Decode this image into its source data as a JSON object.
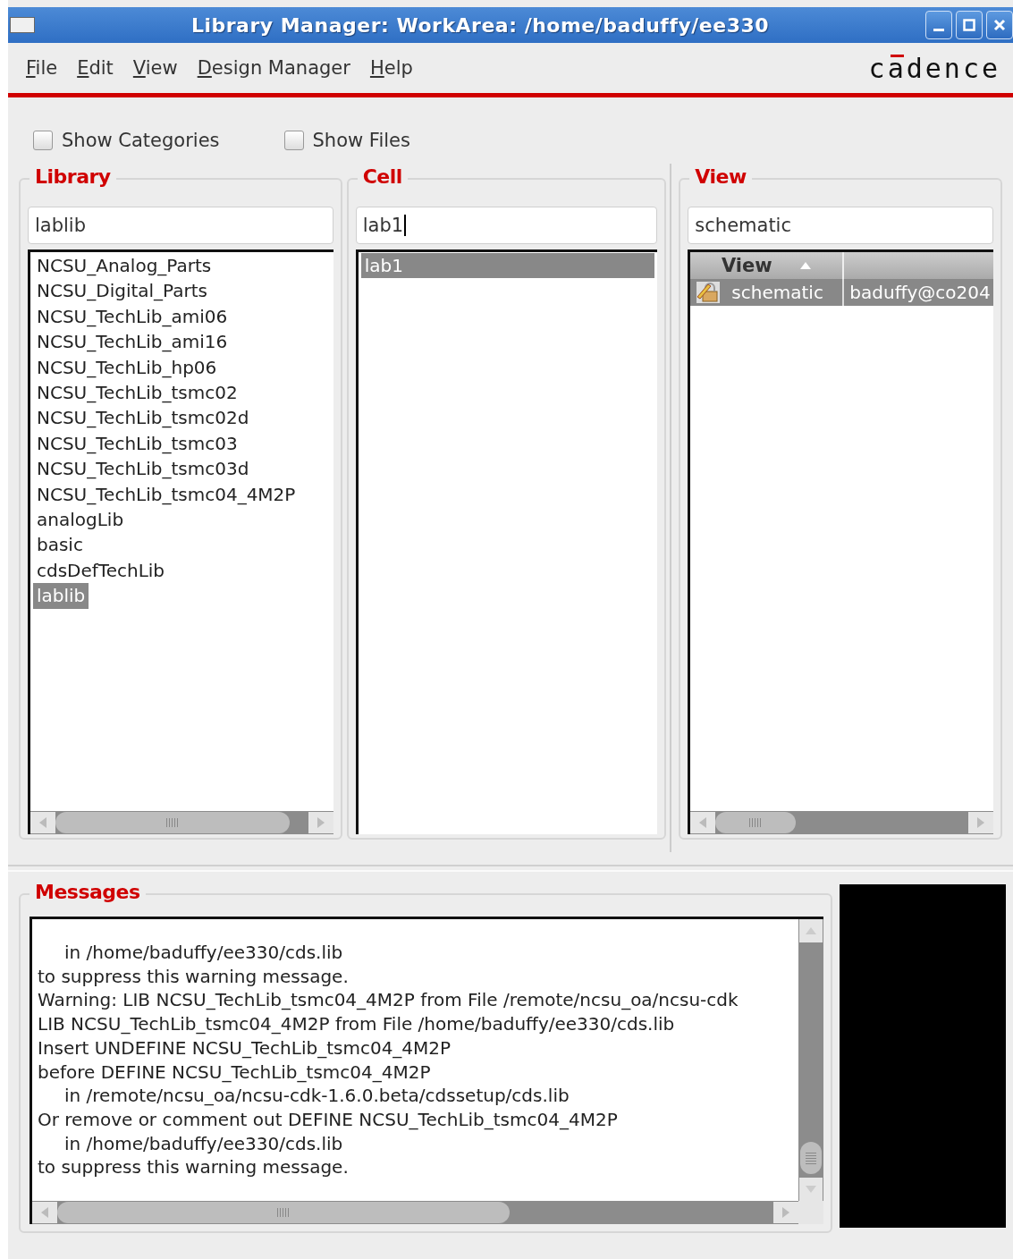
{
  "window": {
    "title": "Library Manager: WorkArea: /home/baduffy/ee330"
  },
  "menu": [
    "File",
    "Edit",
    "View",
    "Design Manager",
    "Help"
  ],
  "logo": "cadence",
  "options": [
    {
      "label": "Show Categories",
      "checked": false
    },
    {
      "label": "Show Files",
      "checked": false
    }
  ],
  "library": {
    "title": "Library",
    "value": "lablib",
    "items": [
      {
        "label": "NCSU_Analog_Parts",
        "selected": false
      },
      {
        "label": "NCSU_Digital_Parts",
        "selected": false
      },
      {
        "label": "NCSU_TechLib_ami06",
        "selected": false
      },
      {
        "label": "NCSU_TechLib_ami16",
        "selected": false
      },
      {
        "label": "NCSU_TechLib_hp06",
        "selected": false
      },
      {
        "label": "NCSU_TechLib_tsmc02",
        "selected": false
      },
      {
        "label": "NCSU_TechLib_tsmc02d",
        "selected": false
      },
      {
        "label": "NCSU_TechLib_tsmc03",
        "selected": false
      },
      {
        "label": "NCSU_TechLib_tsmc03d",
        "selected": false
      },
      {
        "label": "NCSU_TechLib_tsmc04_4M2P",
        "selected": false
      },
      {
        "label": "analogLib",
        "selected": false
      },
      {
        "label": "basic",
        "selected": false
      },
      {
        "label": "cdsDefTechLib",
        "selected": false
      },
      {
        "label": "lablib",
        "selected": true
      }
    ]
  },
  "cell": {
    "title": "Cell",
    "value": "lab1",
    "focused": true,
    "items": [
      {
        "label": "lab1",
        "selected": true
      }
    ]
  },
  "view": {
    "title": "View",
    "value": "schematic",
    "column": "View",
    "rows": [
      {
        "name": "schematic",
        "owner": "baduffy@co204",
        "selected": true
      }
    ]
  },
  "messages": {
    "title": "Messages",
    "lines": [
      {
        "text": "in /home/baduffy/ee330/cds.lib",
        "indented": true
      },
      {
        "text": "to suppress this warning message.",
        "indented": false
      },
      {
        "text": "Warning: LIB NCSU_TechLib_tsmc04_4M2P from File /remote/ncsu_oa/ncsu-cdk",
        "indented": false
      },
      {
        "text": "LIB NCSU_TechLib_tsmc04_4M2P from File /home/baduffy/ee330/cds.lib",
        "indented": false
      },
      {
        "text": "Insert UNDEFINE NCSU_TechLib_tsmc04_4M2P",
        "indented": false
      },
      {
        "text": "before DEFINE NCSU_TechLib_tsmc04_4M2P",
        "indented": false
      },
      {
        "text": "in /remote/ncsu_oa/ncsu-cdk-1.6.0.beta/cdssetup/cds.lib",
        "indented": true
      },
      {
        "text": "Or remove or comment out DEFINE NCSU_TechLib_tsmc04_4M2P",
        "indented": false
      },
      {
        "text": "in /home/baduffy/ee330/cds.lib",
        "indented": true
      },
      {
        "text": "to suppress this warning message.",
        "indented": false
      }
    ]
  }
}
